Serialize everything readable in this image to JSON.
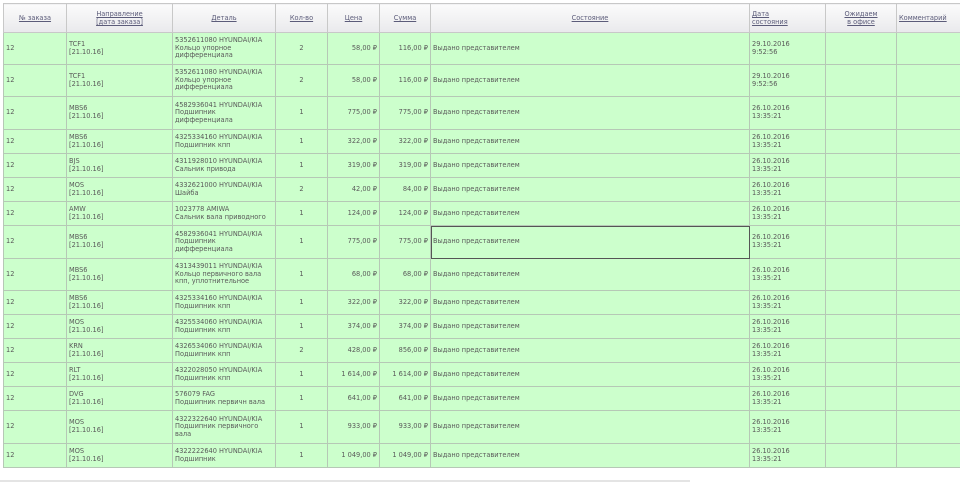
{
  "headers": {
    "order_no": "№ заказа",
    "direction_1": "Направление",
    "direction_2": "[дата заказа]",
    "detail": "Деталь",
    "qty": "Кол-во",
    "price": "Цена",
    "sum": "Сумма",
    "state": "Состояние",
    "state_date_1": "Дата",
    "state_date_2": "состояния",
    "waiting_1": "Ожидаем",
    "waiting_2": "в офисе",
    "comment": "Комментарий"
  },
  "rows": [
    {
      "order": "12",
      "dir": "TCF1",
      "date": "[21.10.16]",
      "detail": [
        "5352611080 HYUNDAI/KIA",
        "Кольцо упорное",
        "дифференциала"
      ],
      "qty": "2",
      "price": "58,00 ₽",
      "sum": "116,00 ₽",
      "state": "Выдано представителем",
      "sdate": "29.10.2016",
      "stime": "9:52:56"
    },
    {
      "order": "12",
      "dir": "TCF1",
      "date": "[21.10.16]",
      "detail": [
        "5352611080 HYUNDAI/KIA",
        "Кольцо упорное",
        "дифференциала"
      ],
      "qty": "2",
      "price": "58,00 ₽",
      "sum": "116,00 ₽",
      "state": "Выдано представителем",
      "sdate": "29.10.2016",
      "stime": "9:52:56"
    },
    {
      "order": "12",
      "dir": "MBS6",
      "date": "[21.10.16]",
      "detail": [
        "4582936041 HYUNDAI/KIA",
        "Подшипник",
        "дифференциала"
      ],
      "qty": "1",
      "price": "775,00 ₽",
      "sum": "775,00 ₽",
      "state": "Выдано представителем",
      "sdate": "26.10.2016",
      "stime": "13:35:21"
    },
    {
      "order": "12",
      "dir": "MBS6",
      "date": "[21.10.16]",
      "detail": [
        "4325334160 HYUNDAI/KIA",
        "Подшипник кпп"
      ],
      "qty": "1",
      "price": "322,00 ₽",
      "sum": "322,00 ₽",
      "state": "Выдано представителем",
      "sdate": "26.10.2016",
      "stime": "13:35:21"
    },
    {
      "order": "12",
      "dir": "BJS",
      "date": "[21.10.16]",
      "detail": [
        "4311928010 HYUNDAI/KIA",
        "Сальник привода"
      ],
      "qty": "1",
      "price": "319,00 ₽",
      "sum": "319,00 ₽",
      "state": "Выдано представителем",
      "sdate": "26.10.2016",
      "stime": "13:35:21"
    },
    {
      "order": "12",
      "dir": "MOS",
      "date": "[21.10.16]",
      "detail": [
        "4332621000 HYUNDAI/KIA",
        "Шайба"
      ],
      "qty": "2",
      "price": "42,00 ₽",
      "sum": "84,00 ₽",
      "state": "Выдано представителем",
      "sdate": "26.10.2016",
      "stime": "13:35:21"
    },
    {
      "order": "12",
      "dir": "AMW",
      "date": "[21.10.16]",
      "detail": [
        "1023778 AMIWA",
        "Сальник вала приводного"
      ],
      "qty": "1",
      "price": "124,00 ₽",
      "sum": "124,00 ₽",
      "state": "Выдано представителем",
      "sdate": "26.10.2016",
      "stime": "13:35:21"
    },
    {
      "order": "12",
      "dir": "MBS6",
      "date": "[21.10.16]",
      "detail": [
        "4582936041 HYUNDAI/KIA",
        "Подшипник",
        "дифференциала"
      ],
      "qty": "1",
      "price": "775,00 ₽",
      "sum": "775,00 ₽",
      "state": "Выдано представителем",
      "sdate": "26.10.2016",
      "stime": "13:35:21",
      "selected": true
    },
    {
      "order": "12",
      "dir": "MBS6",
      "date": "[21.10.16]",
      "detail": [
        "4313439011 HYUNDAI/KIA",
        "Кольцо первичного вала",
        "кпп, уплотнительное"
      ],
      "qty": "1",
      "price": "68,00 ₽",
      "sum": "68,00 ₽",
      "state": "Выдано представителем",
      "sdate": "26.10.2016",
      "stime": "13:35:21"
    },
    {
      "order": "12",
      "dir": "MBS6",
      "date": "[21.10.16]",
      "detail": [
        "4325334160 HYUNDAI/KIA",
        "Подшипник кпп"
      ],
      "qty": "1",
      "price": "322,00 ₽",
      "sum": "322,00 ₽",
      "state": "Выдано представителем",
      "sdate": "26.10.2016",
      "stime": "13:35:21"
    },
    {
      "order": "12",
      "dir": "MOS",
      "date": "[21.10.16]",
      "detail": [
        "4325534060 HYUNDAI/KIA",
        "Подшипник кпп"
      ],
      "qty": "1",
      "price": "374,00 ₽",
      "sum": "374,00 ₽",
      "state": "Выдано представителем",
      "sdate": "26.10.2016",
      "stime": "13:35:21"
    },
    {
      "order": "12",
      "dir": "KRN",
      "date": "[21.10.16]",
      "detail": [
        "4326534060 HYUNDAI/KIA",
        "Подшипник кпп"
      ],
      "qty": "2",
      "price": "428,00 ₽",
      "sum": "856,00 ₽",
      "state": "Выдано представителем",
      "sdate": "26.10.2016",
      "stime": "13:35:21"
    },
    {
      "order": "12",
      "dir": "RLT",
      "date": "[21.10.16]",
      "detail": [
        "4322028050 HYUNDAI/KIA",
        "Подшипник кпп"
      ],
      "qty": "1",
      "price": "1 614,00 ₽",
      "sum": "1 614,00 ₽",
      "state": "Выдано представителем",
      "sdate": "26.10.2016",
      "stime": "13:35:21"
    },
    {
      "order": "12",
      "dir": "DVG",
      "date": "[21.10.16]",
      "detail": [
        "576079 FAG",
        "Подшипник первичн вала"
      ],
      "qty": "1",
      "price": "641,00 ₽",
      "sum": "641,00 ₽",
      "state": "Выдано представителем",
      "sdate": "26.10.2016",
      "stime": "13:35:21"
    },
    {
      "order": "12",
      "dir": "MOS",
      "date": "[21.10.16]",
      "detail": [
        "4322322640 HYUNDAI/KIA",
        "Подшипник первичного",
        "вала"
      ],
      "qty": "1",
      "price": "933,00 ₽",
      "sum": "933,00 ₽",
      "state": "Выдано представителем",
      "sdate": "26.10.2016",
      "stime": "13:35:21"
    },
    {
      "order": "12",
      "dir": "MOS",
      "date": "[21.10.16]",
      "detail": [
        "4322222640 HYUNDAI/KIA",
        "Подшипник"
      ],
      "qty": "1",
      "price": "1 049,00 ₽",
      "sum": "1 049,00 ₽",
      "state": "Выдано представителем",
      "sdate": "26.10.2016",
      "stime": "13:35:21"
    }
  ]
}
